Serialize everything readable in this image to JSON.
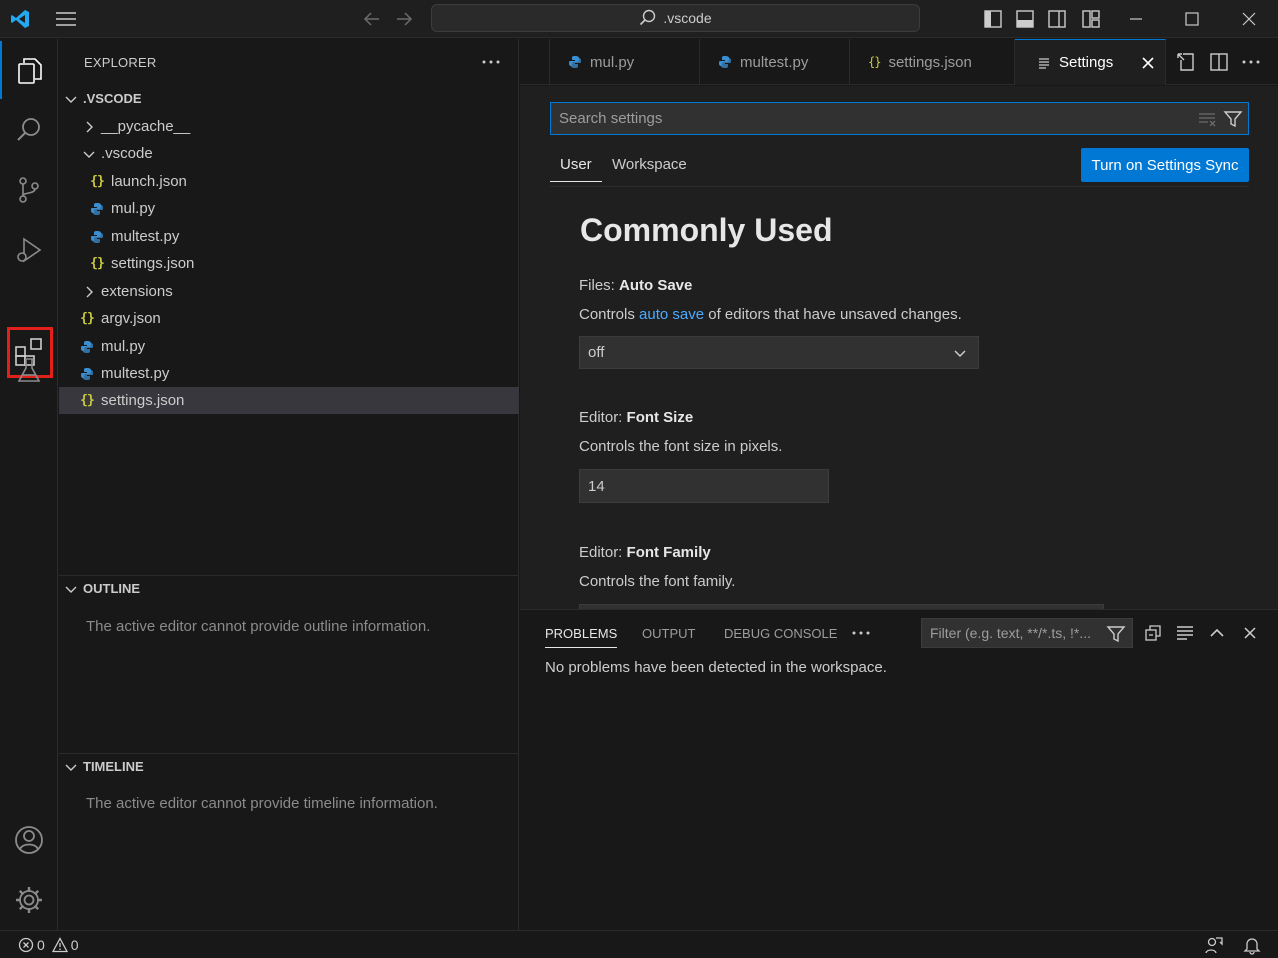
{
  "titlebar": {
    "command_center_text": ".vscode",
    "icons": [
      "vscode-logo",
      "menu-icon",
      "arrow-left-icon",
      "arrow-right-icon",
      "search-icon",
      "toggle-primary-sidebar-icon",
      "toggle-panel-icon",
      "toggle-secondary-sidebar-icon",
      "customize-layout-icon",
      "minimize-icon",
      "maximize-icon",
      "close-icon"
    ]
  },
  "activitybar": {
    "items": [
      "explorer-icon",
      "search-icon",
      "source-control-icon",
      "run-debug-icon",
      "extensions-icon",
      "testing-icon"
    ],
    "bottom": [
      "accounts-icon",
      "manage-gear-icon"
    ],
    "highlight_color": "#e0211b"
  },
  "sidebar": {
    "title": "EXPLORER",
    "root": ".VSCODE",
    "tree": [
      {
        "label": "__pycache__",
        "kind": "folder"
      },
      {
        "label": ".vscode",
        "kind": "folder-open"
      },
      {
        "label": "launch.json",
        "kind": "json"
      },
      {
        "label": "mul.py",
        "kind": "python"
      },
      {
        "label": "multest.py",
        "kind": "python"
      },
      {
        "label": "settings.json",
        "kind": "json"
      },
      {
        "label": "extensions",
        "kind": "folder"
      },
      {
        "label": "argv.json",
        "kind": "json"
      },
      {
        "label": "mul.py",
        "kind": "python"
      },
      {
        "label": "multest.py",
        "kind": "python"
      },
      {
        "label": "settings.json",
        "kind": "json"
      }
    ],
    "outline": {
      "title": "OUTLINE",
      "message": "The active editor cannot provide outline information."
    },
    "timeline": {
      "title": "TIMELINE",
      "message": "The active editor cannot provide timeline information."
    }
  },
  "tabs": [
    {
      "label": "mul.py",
      "kind": "python"
    },
    {
      "label": "multest.py",
      "kind": "python"
    },
    {
      "label": "settings.json",
      "kind": "json"
    },
    {
      "label": "Settings",
      "kind": "settings",
      "active": true
    }
  ],
  "settings": {
    "search_placeholder": "Search settings",
    "scope_tabs": [
      "User",
      "Workspace"
    ],
    "sync_button": "Turn on Settings Sync",
    "section_heading": "Commonly Used",
    "auto_save": {
      "category": "Files: ",
      "name": "Auto Save",
      "desc_before": "Controls ",
      "desc_link": "auto save",
      "desc_after": " of editors that have unsaved changes.",
      "value": "off"
    },
    "font_size": {
      "category": "Editor: ",
      "name": "Font Size",
      "desc": "Controls the font size in pixels.",
      "value": "14"
    },
    "font_family": {
      "category": "Editor: ",
      "name": "Font Family",
      "desc": "Controls the font family."
    }
  },
  "panel": {
    "tabs": [
      "PROBLEMS",
      "OUTPUT",
      "DEBUG CONSOLE"
    ],
    "filter_placeholder": "Filter (e.g. text, **/*.ts, !*...",
    "message": "No problems have been detected in the workspace."
  },
  "statusbar": {
    "errors": "0",
    "warnings": "0"
  },
  "colors": {
    "accent": "#0078d4",
    "python_icon": "#3b8ed0",
    "json_icon": "#cbcb41",
    "link": "#4daafc"
  }
}
